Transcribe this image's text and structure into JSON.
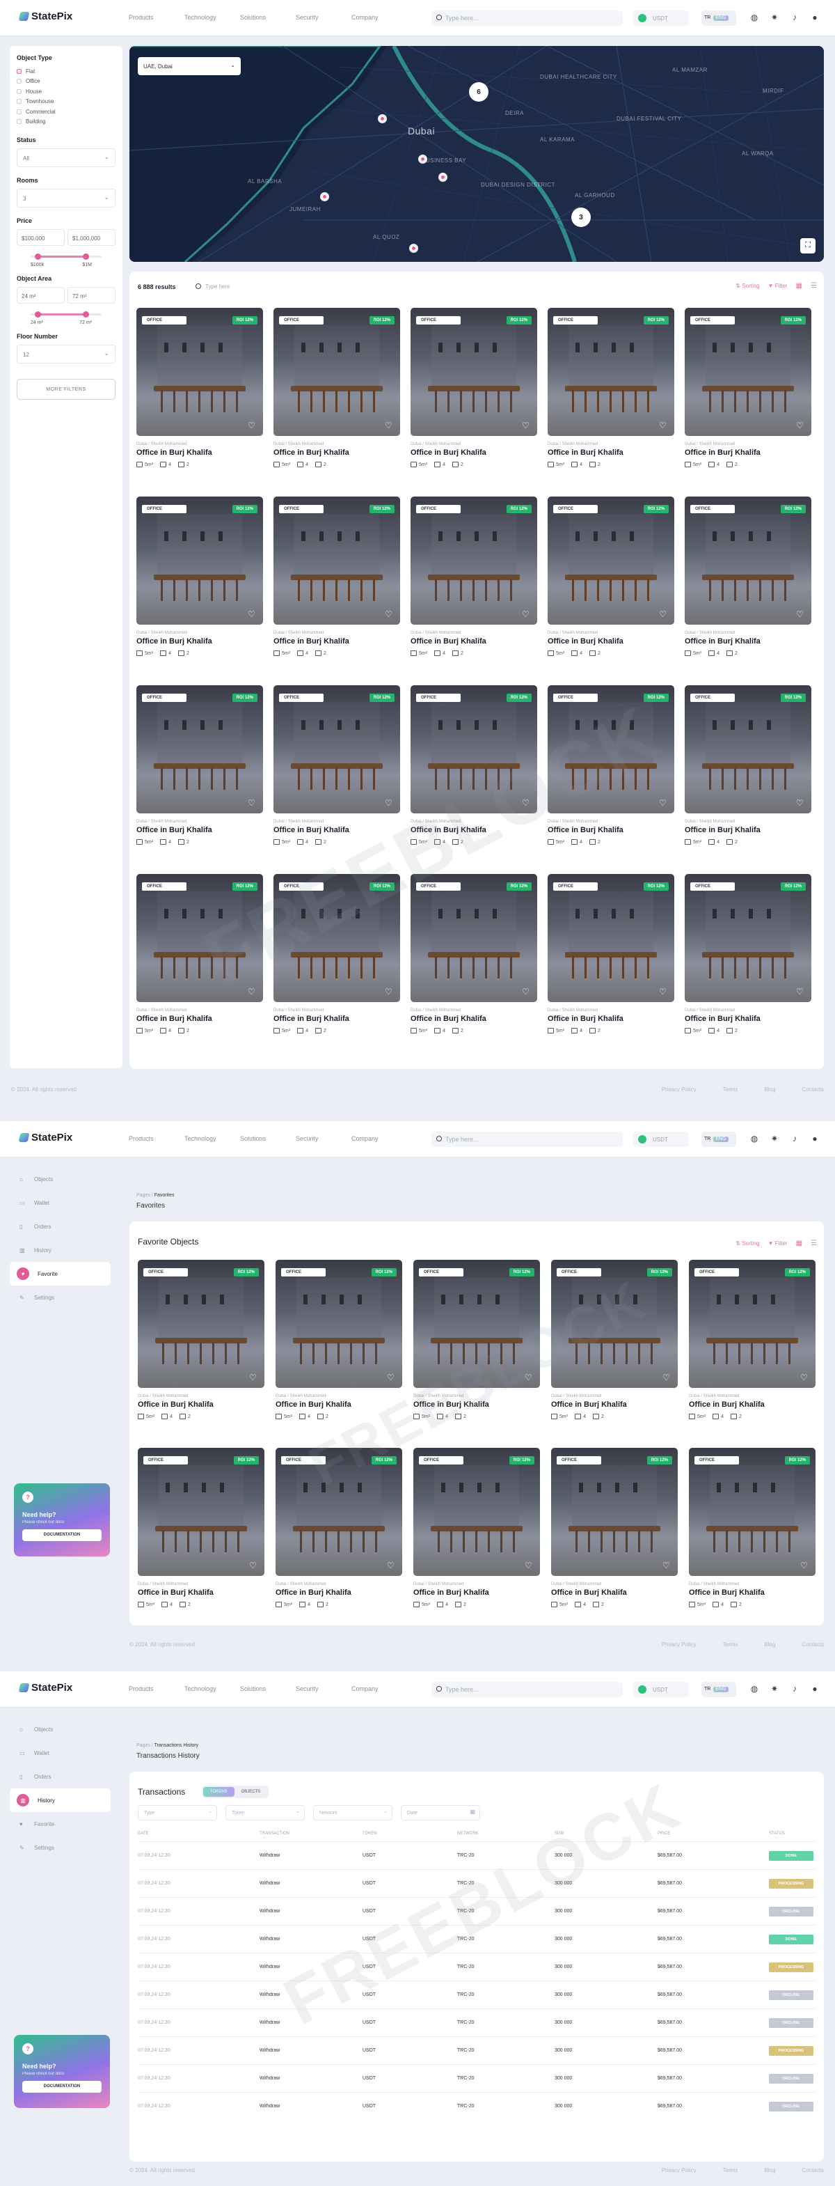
{
  "app": {
    "name": "StatePix"
  },
  "header": {
    "nav": [
      "Products",
      "Technology",
      "Solutions",
      "Security",
      "Company"
    ],
    "search_placeholder": "Type here...",
    "wallet_label": "USDT",
    "lang": [
      "TR",
      "ENG"
    ]
  },
  "filters": {
    "object_type_title": "Object Type",
    "object_types": [
      "Flat",
      "Office",
      "House",
      "Townhouse",
      "Commercial",
      "Building"
    ],
    "status_title": "Status",
    "status_value": "All",
    "rooms_title": "Rooms",
    "rooms_value": "3",
    "price_title": "Price",
    "price_from": "$100,000",
    "price_to": "$1,000,000",
    "price_min_label": "$100k",
    "price_max_label": "$1M",
    "area_title": "Object Area",
    "area_from": "24 m²",
    "area_to": "72 m²",
    "area_min_label": "24 m²",
    "area_max_label": "72 m²",
    "floor_title": "Floor Number",
    "floor_value": "12",
    "more_filters": "MORE FILTERS"
  },
  "map": {
    "location_select": "UAE, Dubai",
    "labels": [
      "Dubai",
      "DEIRA",
      "AL BARSHA",
      "JUMEIRAH",
      "DUBAI DESIGN DISTRICT",
      "DUBAI HEALTHCARE CITY",
      "AL QUOZ",
      "AL WARQA",
      "MIRDIF",
      "AL KARAMA",
      "BUSINESS BAY",
      "AL GARHOUD",
      "AL MAMZAR",
      "DUBAI FESTIVAL CITY"
    ],
    "clusters": [
      "6",
      "3"
    ],
    "fullscreen_icon": "fullscreen-icon"
  },
  "listing": {
    "count": "6 888 results",
    "search_placeholder": "Type here",
    "sorting": "Sorting",
    "filter": "Filter"
  },
  "card": {
    "type": "OFFICE",
    "roi": "ROI 12%",
    "location": "Dubai / Sheikh Mohammed",
    "title": "Office in Burj Khalifa",
    "area": "5m²",
    "rooms": "4",
    "baths": "2"
  },
  "footer": {
    "copyright": "© 2024. All rights reserved",
    "links": [
      "Privacy Policy",
      "Terms",
      "Blog",
      "Contacts"
    ]
  },
  "sidebar": {
    "items": [
      "Objects",
      "Wallet",
      "Orders",
      "History",
      "Favorite",
      "Settings"
    ]
  },
  "help": {
    "title": "Need help?",
    "subtitle": "Please check our docs",
    "button": "DOCUMENTATION"
  },
  "favorites": {
    "crumb_root": "Pages",
    "crumb_current": "Favorites",
    "page_title": "Favorites",
    "panel_title": "Favorite Objects"
  },
  "transactions": {
    "crumb_root": "Pages",
    "crumb_current": "Transactions History",
    "page_title": "Transactions History",
    "panel_title": "Transactions",
    "tabs": [
      "TOKENS",
      "OBJECTS"
    ],
    "filters": [
      "Type",
      "Token",
      "Network",
      "Date"
    ],
    "columns": [
      "DATE",
      "TRANSACTION",
      "TOKEN",
      "NETWORK",
      "SUM",
      "PRICE",
      "STATUS"
    ],
    "rows": [
      {
        "date": "07.03.24 12:30",
        "tx": "Withdraw",
        "token": "USDT",
        "network": "TRC-20",
        "sum": "300 000",
        "price": "$69,587.00",
        "status": "DONE"
      },
      {
        "date": "07.03.24 12:30",
        "tx": "Withdraw",
        "token": "USDT",
        "network": "TRC-20",
        "sum": "300 000",
        "price": "$69,587.00",
        "status": "PROCESSING"
      },
      {
        "date": "07.03.24 12:30",
        "tx": "Withdraw",
        "token": "USDT",
        "network": "TRC-20",
        "sum": "300 000",
        "price": "$69,587.00",
        "status": "DECLINE"
      },
      {
        "date": "07.03.24 12:30",
        "tx": "Withdraw",
        "token": "USDT",
        "network": "TRC-20",
        "sum": "300 000",
        "price": "$69,587.00",
        "status": "DONE"
      },
      {
        "date": "07.03.24 12:30",
        "tx": "Withdraw",
        "token": "USDT",
        "network": "TRC-20",
        "sum": "300 000",
        "price": "$69,587.00",
        "status": "PROCESSING"
      },
      {
        "date": "07.03.24 12:30",
        "tx": "Withdraw",
        "token": "USDT",
        "network": "TRC-20",
        "sum": "300 000",
        "price": "$69,587.00",
        "status": "DECLINE"
      },
      {
        "date": "07.03.24 12:30",
        "tx": "Withdraw",
        "token": "USDT",
        "network": "TRC-20",
        "sum": "300 000",
        "price": "$69,587.00",
        "status": "DECLINE"
      },
      {
        "date": "07.03.24 12:30",
        "tx": "Withdraw",
        "token": "USDT",
        "network": "TRC-20",
        "sum": "300 000",
        "price": "$69,587.00",
        "status": "PROCESSING"
      },
      {
        "date": "07.03.24 12:30",
        "tx": "Withdraw",
        "token": "USDT",
        "network": "TRC-20",
        "sum": "300 000",
        "price": "$69,587.00",
        "status": "DECLINE"
      },
      {
        "date": "07.03.24 12:30",
        "tx": "Withdraw",
        "token": "USDT",
        "network": "TRC-20",
        "sum": "300 000",
        "price": "$69,587.00",
        "status": "DECLINE"
      }
    ]
  },
  "watermark": "FREEBLOCK",
  "colors": {
    "accent": "#e05c97",
    "done": "#5fd3a7",
    "processing": "#d9c27a",
    "decline": "#c4c9d4",
    "roi": "#26b36c"
  }
}
